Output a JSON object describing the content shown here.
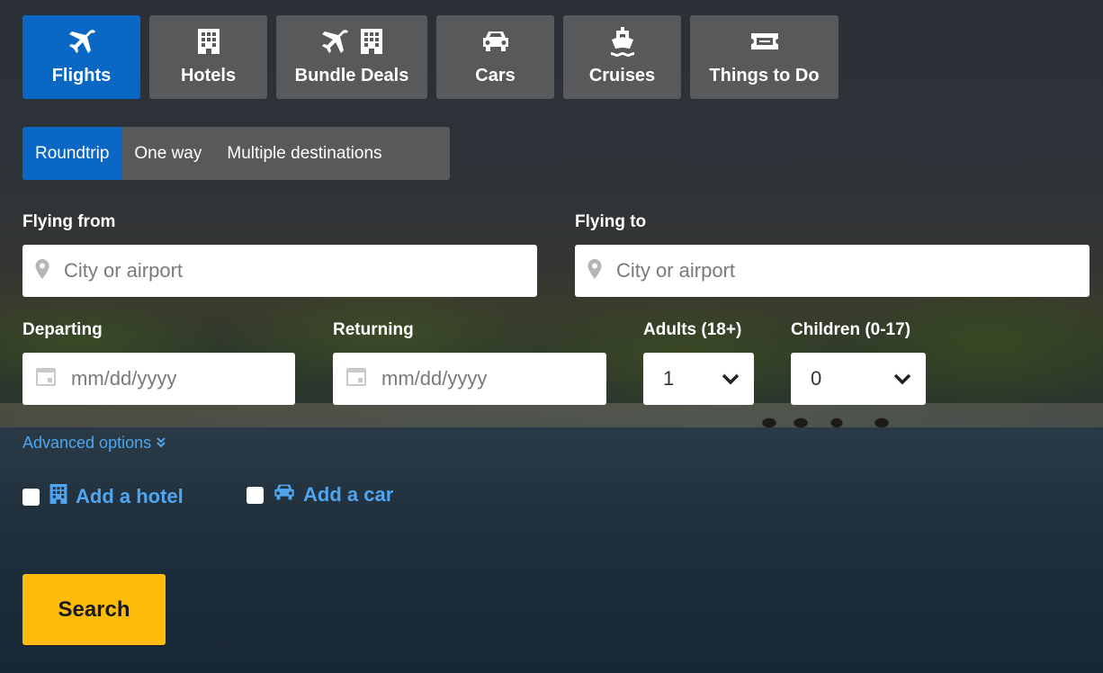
{
  "tabs": [
    {
      "label": "Flights",
      "icon": "plane-icon",
      "active": true
    },
    {
      "label": "Hotels",
      "icon": "hotel-icon",
      "active": false
    },
    {
      "label": "Bundle Deals",
      "icon": "plane-hotel-icon",
      "active": false
    },
    {
      "label": "Cars",
      "icon": "car-icon",
      "active": false
    },
    {
      "label": "Cruises",
      "icon": "cruise-ship-icon",
      "active": false
    },
    {
      "label": "Things to Do",
      "icon": "ticket-icon",
      "active": false
    }
  ],
  "trip_type": {
    "options": [
      "Roundtrip",
      "One way",
      "Multiple destinations"
    ],
    "selected": "Roundtrip"
  },
  "flying_from": {
    "label": "Flying from",
    "placeholder": "City or airport",
    "value": ""
  },
  "flying_to": {
    "label": "Flying to",
    "placeholder": "City or airport",
    "value": ""
  },
  "departing": {
    "label": "Departing",
    "placeholder": "mm/dd/yyyy",
    "value": ""
  },
  "returning": {
    "label": "Returning",
    "placeholder": "mm/dd/yyyy",
    "value": ""
  },
  "adults": {
    "label": "Adults (18+)",
    "value": "1"
  },
  "children": {
    "label": "Children (0-17)",
    "value": "0"
  },
  "advanced_options": "Advanced options",
  "add_hotel": {
    "label": "Add a hotel",
    "checked": false
  },
  "add_car": {
    "label": "Add a car",
    "checked": false
  },
  "search_label": "Search",
  "colors": {
    "accent_blue": "#0a68c4",
    "link_blue": "#4fa6ef",
    "search_yellow": "#fdbb0c"
  }
}
